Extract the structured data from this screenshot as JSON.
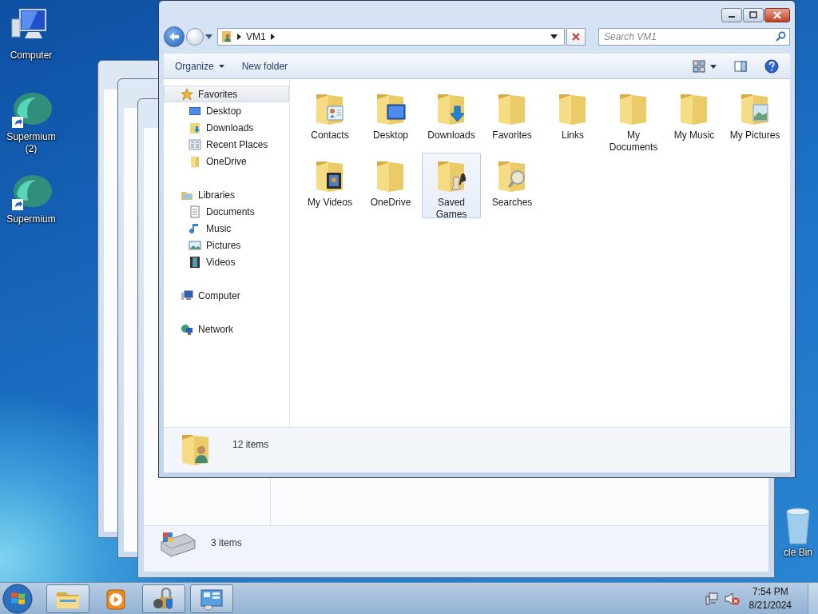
{
  "desktop_icons": [
    {
      "label": "Computer",
      "kind": "computer"
    },
    {
      "label": "Supermium (2)",
      "kind": "browser"
    },
    {
      "label": "Supermium",
      "kind": "browser"
    },
    {
      "label": "cle Bin",
      "kind": "recycle"
    }
  ],
  "back_window": {
    "status": "3 items"
  },
  "window": {
    "address": [
      "VM1"
    ],
    "search": {
      "placeholder": "Search VM1"
    },
    "toolbar": [
      {
        "label": "Organize",
        "kind": "menu"
      },
      {
        "label": "New folder",
        "kind": "button"
      }
    ],
    "nav": [
      {
        "label": "Favorites",
        "kind": "favorites",
        "selected": true,
        "children": [
          {
            "label": "Desktop",
            "kind": "desktop"
          },
          {
            "label": "Downloads",
            "kind": "downloads"
          },
          {
            "label": "Recent Places",
            "kind": "recent"
          },
          {
            "label": "OneDrive",
            "kind": "folder"
          }
        ]
      },
      {
        "label": "Libraries",
        "kind": "libraries",
        "selected": false,
        "children": [
          {
            "label": "Documents",
            "kind": "documents"
          },
          {
            "label": "Music",
            "kind": "music"
          },
          {
            "label": "Pictures",
            "kind": "pictures"
          },
          {
            "label": "Videos",
            "kind": "videos"
          }
        ]
      },
      {
        "label": "Computer",
        "kind": "computer",
        "selected": false
      },
      {
        "label": "Network",
        "kind": "network",
        "selected": false
      }
    ],
    "items": [
      {
        "label": "Contacts",
        "kind": "contacts",
        "selected": false
      },
      {
        "label": "Desktop",
        "kind": "desktop",
        "selected": false
      },
      {
        "label": "Downloads",
        "kind": "downloads",
        "selected": false
      },
      {
        "label": "Favorites",
        "kind": "plain",
        "selected": false
      },
      {
        "label": "Links",
        "kind": "plain",
        "selected": false
      },
      {
        "label": "My Documents",
        "kind": "plain",
        "selected": false
      },
      {
        "label": "My Music",
        "kind": "plain",
        "selected": false
      },
      {
        "label": "My Pictures",
        "kind": "pictures",
        "selected": false
      },
      {
        "label": "My Videos",
        "kind": "videos",
        "selected": false
      },
      {
        "label": "OneDrive",
        "kind": "plain",
        "selected": false
      },
      {
        "label": "Saved Games",
        "kind": "games",
        "selected": true
      },
      {
        "label": "Searches",
        "kind": "search",
        "selected": false
      }
    ],
    "status": "12 items"
  },
  "taskbar": {
    "buttons": [
      {
        "kind": "explorer",
        "running": true
      },
      {
        "kind": "media",
        "running": false
      },
      {
        "kind": "security",
        "running": true
      },
      {
        "kind": "control",
        "running": true
      }
    ],
    "time": "7:54 PM",
    "date": "8/21/2024"
  }
}
